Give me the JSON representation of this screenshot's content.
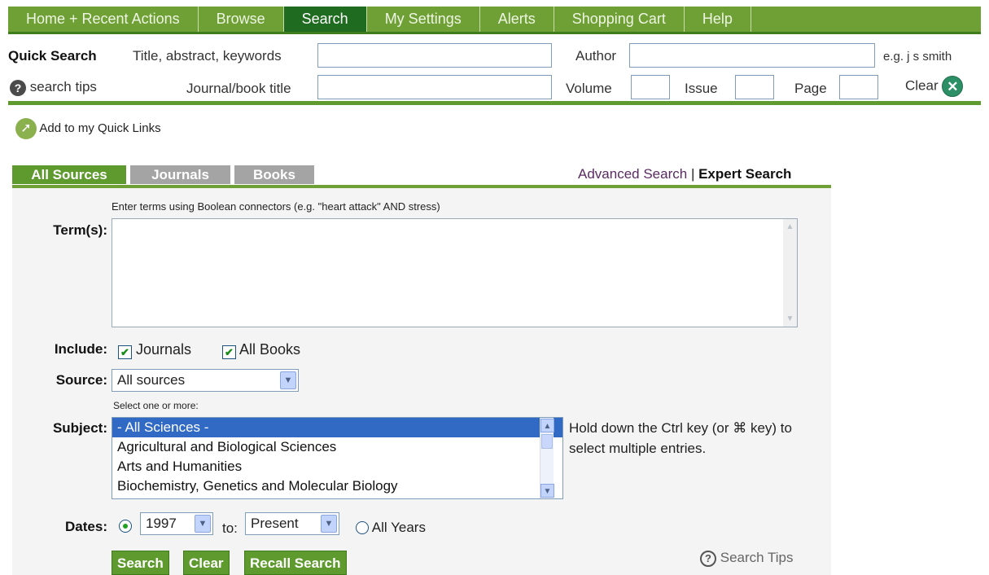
{
  "nav": {
    "tabs": [
      {
        "label": "Home + Recent Actions"
      },
      {
        "label": "Browse"
      },
      {
        "label": "Search"
      },
      {
        "label": "My Settings"
      },
      {
        "label": "Alerts"
      },
      {
        "label": "Shopping Cart"
      },
      {
        "label": "Help"
      }
    ],
    "active_tab": "Search"
  },
  "quick_search": {
    "title": "Quick Search",
    "title_abstract_label": "Title, abstract, keywords",
    "author_label": "Author",
    "author_hint": "e.g. j s smith",
    "search_tips_label": "search tips",
    "journal_label": "Journal/book title",
    "volume_label": "Volume",
    "issue_label": "Issue",
    "page_label": "Page",
    "clear_label": "Clear"
  },
  "quick_links": {
    "label": "Add to my Quick Links"
  },
  "source_tabs": [
    {
      "label": "All Sources"
    },
    {
      "label": "Journals"
    },
    {
      "label": "Books"
    }
  ],
  "search_mode_links": {
    "advanced": "Advanced Search",
    "separator": "|",
    "expert": "Expert Search"
  },
  "form": {
    "terms_hint": "Enter terms using Boolean connectors (e.g. \"heart attack\" AND stress)",
    "terms_label": "Term(s):",
    "terms_value": "",
    "include_label": "Include:",
    "include_options": [
      {
        "label": "Journals",
        "checked": true
      },
      {
        "label": "All Books",
        "checked": true
      }
    ],
    "source_label": "Source:",
    "source_value": "All sources",
    "subject_hint": "Select one or more:",
    "subject_label": "Subject:",
    "subjects": [
      "- All Sciences -",
      "Agricultural and Biological Sciences",
      "Arts and Humanities",
      "Biochemistry, Genetics and Molecular Biology"
    ],
    "subject_selected": "- All Sciences -",
    "multi_select_note": "Hold down the Ctrl key (or ⌘ key) to select multiple entries.",
    "dates_label": "Dates:",
    "date_from": "1997",
    "date_to_label": "to:",
    "date_to": "Present",
    "all_years_label": "All Years",
    "date_mode": "range"
  },
  "buttons": {
    "search": "Search",
    "clear": "Clear",
    "recall": "Recall Search"
  },
  "search_tips_link": "Search Tips",
  "colors": {
    "nav_green": "#6fa035",
    "nav_active": "#1f6c21",
    "tab_active": "#5e9a2e",
    "tab_inactive": "#a4a4a4",
    "advanced_link": "#5a2b63",
    "selection_blue": "#316ac5"
  }
}
